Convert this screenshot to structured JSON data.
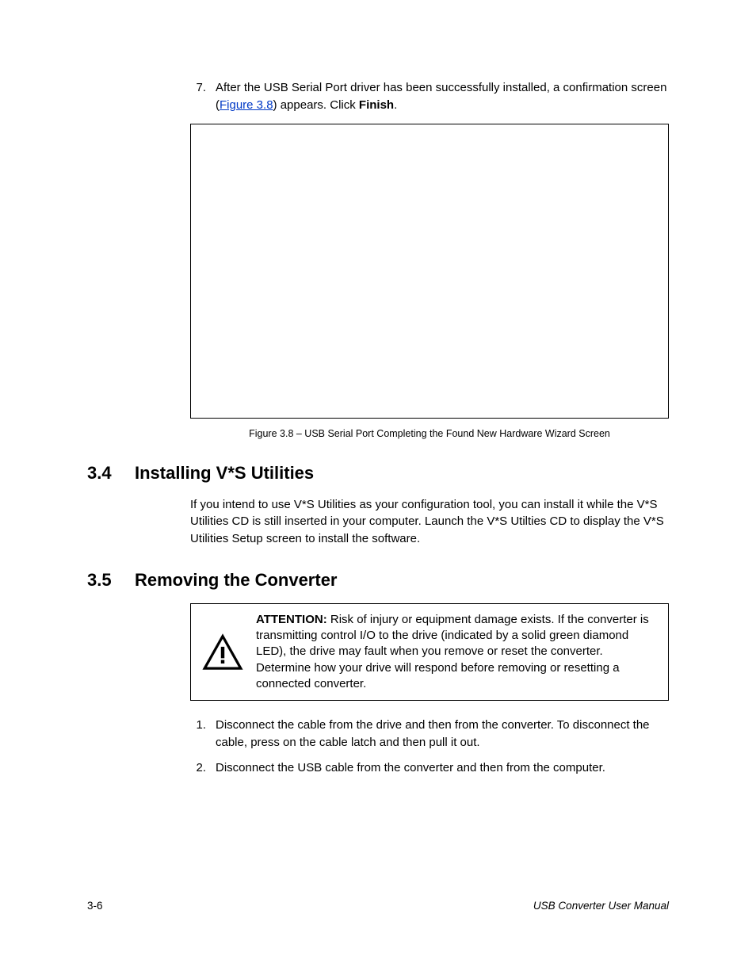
{
  "step7": {
    "num": "7.",
    "pre": "After the USB Serial Port driver has been successfully installed, a confirmation screen (",
    "link": "Figure 3.8",
    "mid": ") appears. Click ",
    "bold": "Finish",
    "post": "."
  },
  "figure": {
    "caption": "Figure 3.8 – USB Serial Port Completing the Found New Hardware Wizard Screen"
  },
  "sec34": {
    "num": "3.4",
    "title": "Installing V*S Utilities",
    "body": "If you intend to use V*S Utilities as your configuration tool, you can install it while the V*S Utilities CD is still inserted in your computer. Launch the V*S Utilties CD to display the V*S Utilities Setup screen to install the software."
  },
  "sec35": {
    "num": "3.5",
    "title": "Removing the Converter",
    "attention_label": "ATTENTION:",
    "attention_body": "  Risk of injury or equipment damage exists. If the converter is transmitting control I/O to the drive (indicated by a solid green diamond LED), the drive may fault when you remove or reset the converter. Determine how your drive will respond before removing or resetting a connected converter.",
    "step1": {
      "num": "1.",
      "text": "Disconnect the cable from the drive and then from the converter. To disconnect the cable, press on the cable latch and then pull it out."
    },
    "step2": {
      "num": "2.",
      "text": "Disconnect the USB cable from the converter and then from the computer."
    }
  },
  "footer": {
    "left": "3-6",
    "right": "USB Converter User Manual"
  }
}
